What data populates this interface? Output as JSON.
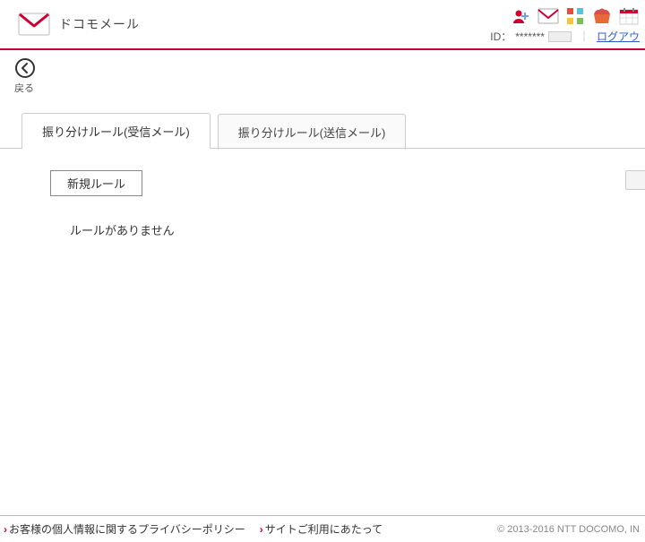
{
  "header": {
    "app_title": "ドコモメール",
    "id_label": "ID：",
    "id_mask": "*******",
    "logout_label": "ログアウ"
  },
  "back": {
    "label": "戻る"
  },
  "tabs": {
    "incoming": "振り分けルール(受信メール)",
    "outgoing": "振り分けルール(送信メール)"
  },
  "content": {
    "new_rule_label": "新規ルール",
    "empty_message": "ルールがありません"
  },
  "footer": {
    "privacy": "お客様の個人情報に関するプライバシーポリシー",
    "terms": "サイトご利用にあたって",
    "copyright": "© 2013-2016 NTT DOCOMO, IN"
  }
}
